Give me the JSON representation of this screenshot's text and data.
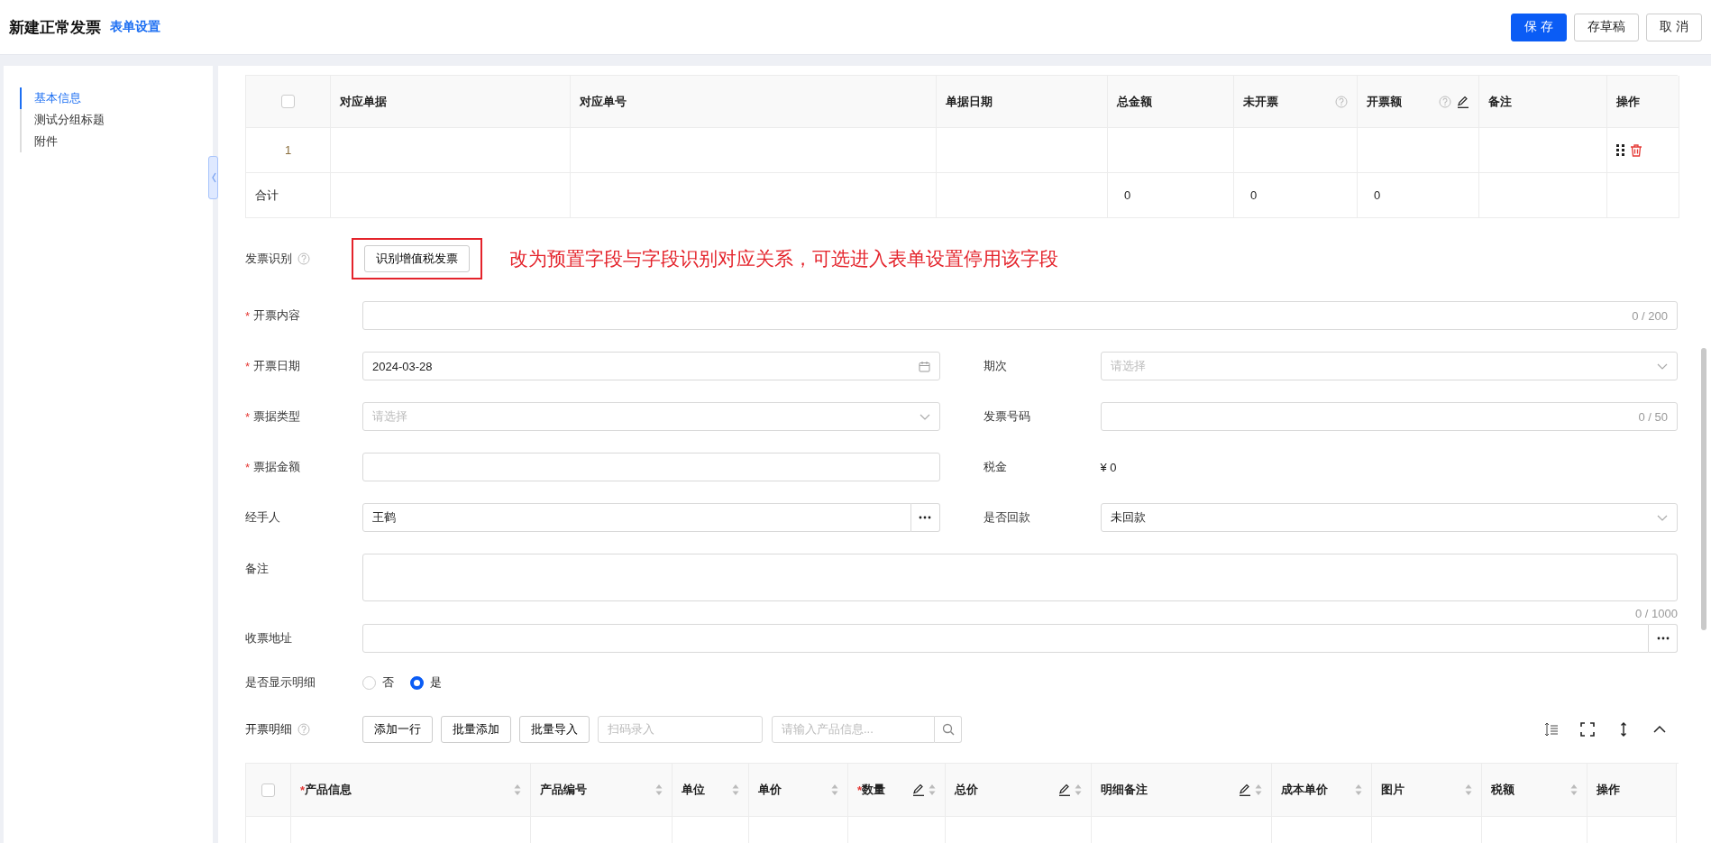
{
  "header": {
    "title": "新建正常发票",
    "link": "表单设置",
    "buttons": [
      {
        "label": "保 存",
        "kind": "primary"
      },
      {
        "label": "存草稿",
        "kind": "default"
      },
      {
        "label": "取 消",
        "kind": "default"
      }
    ]
  },
  "sidebar": {
    "items": [
      {
        "label": "基本信息",
        "selected": true
      },
      {
        "label": "测试分组标题",
        "selected": false
      },
      {
        "label": "附件",
        "selected": false
      }
    ]
  },
  "source_table": {
    "select_all": {
      "checked": false
    },
    "columns": [
      {
        "label": "对应单据",
        "help": false,
        "editable": false
      },
      {
        "label": "对应单号",
        "help": false,
        "editable": false
      },
      {
        "label": "单据日期",
        "help": false,
        "editable": false
      },
      {
        "label": "总金额",
        "help": false,
        "editable": false,
        "total": "0"
      },
      {
        "label": "未开票",
        "help": true,
        "editable": false,
        "total": "0"
      },
      {
        "label": "开票额",
        "help": true,
        "editable": true,
        "total": "0"
      },
      {
        "label": "备注",
        "help": false,
        "editable": false
      },
      {
        "label": "操作",
        "help": false,
        "editable": false
      }
    ],
    "rows": [
      {
        "index": "1"
      }
    ],
    "total_label": "合计"
  },
  "form": {
    "rows": [
      {
        "fields": [
          {
            "kind": "button",
            "label": "发票识别",
            "help": true,
            "button": "识别增值税发票",
            "annotation": "改为预置字段与字段识别对应关系，可选进入表单设置停用该字段"
          }
        ]
      },
      {
        "fields": [
          {
            "kind": "text",
            "required_mark": "*",
            "label": "开票内容",
            "counter": "0 / 200"
          }
        ]
      },
      {
        "fields": [
          {
            "kind": "date",
            "required_mark": "*",
            "label": "开票日期",
            "value": "2024-03-28"
          },
          {
            "kind": "select",
            "label": "期次",
            "placeholder": "请选择"
          }
        ]
      },
      {
        "fields": [
          {
            "kind": "select",
            "required_mark": "*",
            "label": "票据类型",
            "placeholder": "请选择"
          },
          {
            "kind": "text",
            "label": "发票号码",
            "counter": "0 / 50"
          }
        ]
      },
      {
        "fields": [
          {
            "kind": "text",
            "required_mark": "*",
            "label": "票据金额"
          },
          {
            "kind": "static",
            "label": "税金",
            "value": "¥ 0"
          }
        ]
      },
      {
        "fields": [
          {
            "kind": "picker",
            "label": "经手人",
            "value": "王鹤"
          },
          {
            "kind": "select",
            "label": "是否回款",
            "value": "未回款"
          }
        ]
      },
      {
        "fields": [
          {
            "kind": "textarea",
            "label": "备注",
            "counter": "0 / 1000"
          }
        ]
      },
      {
        "fields": [
          {
            "kind": "picker",
            "label": "收票地址"
          }
        ]
      },
      {
        "fields": [
          {
            "kind": "radio",
            "label": "是否显示明细",
            "options": [
              {
                "label": "否",
                "selected": false
              },
              {
                "label": "是",
                "selected": true
              }
            ]
          }
        ]
      }
    ]
  },
  "detail": {
    "label": "开票明细",
    "help": true,
    "buttons": [
      "添加一行",
      "批量添加",
      "批量导入"
    ],
    "scan": {
      "placeholder": "扫码录入"
    },
    "search": {
      "placeholder": "请输入产品信息..."
    },
    "select_all": {
      "checked": false
    },
    "columns": [
      {
        "label": "产品信息",
        "required_mark": "*",
        "editable": false,
        "sortable": true
      },
      {
        "label": "产品编号",
        "editable": false,
        "sortable": true
      },
      {
        "label": "单位",
        "editable": false,
        "sortable": true
      },
      {
        "label": "单价",
        "editable": false,
        "sortable": true
      },
      {
        "label": "数量",
        "required_mark": "*",
        "editable": true,
        "sortable": true
      },
      {
        "label": "总价",
        "editable": true,
        "sortable": true
      },
      {
        "label": "明细备注",
        "editable": true,
        "sortable": true
      },
      {
        "label": "成本单价",
        "editable": false,
        "sortable": true
      },
      {
        "label": "图片",
        "editable": false,
        "sortable": true
      },
      {
        "label": "税额",
        "editable": false,
        "sortable": true
      },
      {
        "label": "操作",
        "editable": false,
        "sortable": false
      }
    ]
  }
}
